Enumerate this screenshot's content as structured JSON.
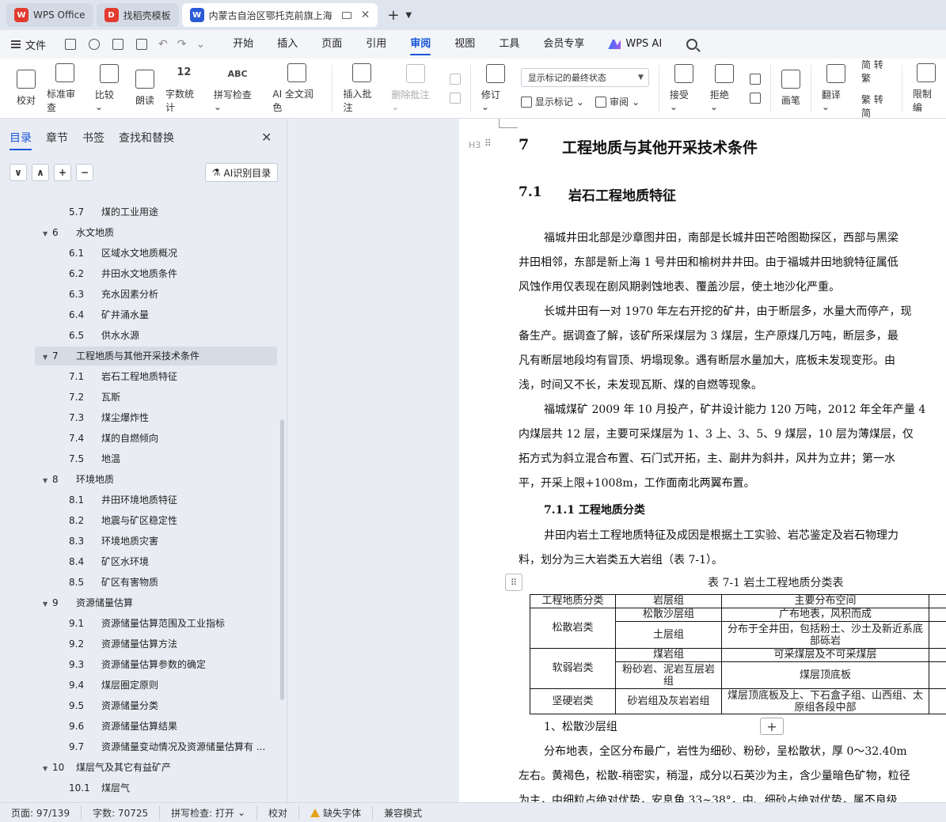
{
  "tabs": [
    {
      "label": "WPS Office",
      "logo": "W",
      "logo_color": "#e23b2e"
    },
    {
      "label": "找稻壳模板",
      "logo": "D",
      "logo_color": "#e23b2e"
    },
    {
      "label": "内蒙古自治区鄂托克前旗上海",
      "logo": "W",
      "logo_color": "#2a5bd7",
      "active": true
    }
  ],
  "menubar": {
    "file": "文件",
    "items": [
      "开始",
      "插入",
      "页面",
      "引用",
      "审阅",
      "视图",
      "工具",
      "会员专享"
    ],
    "active": "审阅",
    "wps_ai": "WPS AI"
  },
  "ribbon": {
    "proofread": "校对",
    "standard_review": "标准审查",
    "compare": "比较",
    "read_aloud": "朗读",
    "word_count": "字数统计",
    "word_count_icon_text": "12",
    "spell_check": "拼写检查",
    "spell_check_icon_text": "ABC",
    "ai_polish": "AI 全文润色",
    "insert_comment": "插入批注",
    "delete_comment": "删除批注",
    "revision": "修订",
    "markup_select": "显示标记的最终状态",
    "show_markup": "显示标记",
    "review": "审阅",
    "accept": "接受",
    "reject": "拒绝",
    "brush": "画笔",
    "translate": "翻译",
    "to_traditional": "简 转繁",
    "to_simplified": "繁 转简",
    "restrict_edit": "限制编"
  },
  "nav": {
    "tabs": [
      "目录",
      "章节",
      "书签",
      "查找和替换"
    ],
    "active_tab": "目录",
    "tools": [
      "∨",
      "∧",
      "+",
      "−"
    ],
    "ai_toc": "AI识别目录",
    "items": [
      {
        "num": "5.7",
        "text": "煤的工业用途",
        "level": 2
      },
      {
        "num": "6",
        "text": "水文地质",
        "level": 1
      },
      {
        "num": "6.1",
        "text": "区域水文地质概况",
        "level": 2
      },
      {
        "num": "6.2",
        "text": "井田水文地质条件",
        "level": 2
      },
      {
        "num": "6.3",
        "text": "充水因素分析",
        "level": 2
      },
      {
        "num": "6.4",
        "text": "矿井涌水量",
        "level": 2
      },
      {
        "num": "6.5",
        "text": "供水水源",
        "level": 2
      },
      {
        "num": "7",
        "text": "工程地质与其他开采技术条件",
        "level": 1,
        "selected": true
      },
      {
        "num": "7.1",
        "text": "岩石工程地质特征",
        "level": 2
      },
      {
        "num": "7.2",
        "text": "瓦斯",
        "level": 2
      },
      {
        "num": "7.3",
        "text": "煤尘爆炸性",
        "level": 2
      },
      {
        "num": "7.4",
        "text": "煤的自燃倾向",
        "level": 2
      },
      {
        "num": "7.5",
        "text": "地温",
        "level": 2
      },
      {
        "num": "8",
        "text": "环境地质",
        "level": 1
      },
      {
        "num": "8.1",
        "text": "井田环境地质特征",
        "level": 2
      },
      {
        "num": "8.2",
        "text": "地震与矿区稳定性",
        "level": 2
      },
      {
        "num": "8.3",
        "text": "环境地质灾害",
        "level": 2
      },
      {
        "num": "8.4",
        "text": "矿区水环境",
        "level": 2
      },
      {
        "num": "8.5",
        "text": "矿区有害物质",
        "level": 2
      },
      {
        "num": "9",
        "text": "资源储量估算",
        "level": 1
      },
      {
        "num": "9.1",
        "text": "资源储量估算范围及工业指标",
        "level": 2
      },
      {
        "num": "9.2",
        "text": "资源储量估算方法",
        "level": 2
      },
      {
        "num": "9.3",
        "text": "资源储量估算参数的确定",
        "level": 2
      },
      {
        "num": "9.4",
        "text": "煤层圈定原则",
        "level": 2
      },
      {
        "num": "9.5",
        "text": "资源储量分类",
        "level": 2
      },
      {
        "num": "9.6",
        "text": "资源储量估算结果",
        "level": 2
      },
      {
        "num": "9.7",
        "text": "资源储量变动情况及资源储量估算有 ...",
        "level": 2
      },
      {
        "num": "10",
        "text": "煤层气及其它有益矿产",
        "level": 1
      },
      {
        "num": "10.1",
        "text": "煤层气",
        "level": 2
      }
    ]
  },
  "doc": {
    "heading_marker": "H3",
    "h1_num": "7",
    "h1_text": "工程地质与其他开采技术条件",
    "h2_num": "7.1",
    "h2_text": "岩石工程地质特征",
    "lines": [
      "福城井田北部是沙章图井田，南部是长城井田芒哈图勘探区，西部与黑梁",
      "井田相邻，东部是新上海 1 号井田和榆树井井田。由于福城井田地貌特征属低",
      "风蚀作用仅表现在剧风期剥蚀地表、覆盖沙层，使土地沙化严重。",
      "长城井田有一对 1970 年左右开挖的矿井，由于断层多，水量大而停产，现",
      "备生产。据调查了解，该矿所采煤层为 3 煤层，生产原煤几万吨，断层多，最",
      "凡有断层地段均有冒顶、坍塌现象。遇有断层水量加大，底板未发现变形。由",
      "浅，时间又不长，未发现瓦斯、煤的自燃等现象。",
      "福城煤矿 2009 年 10 月投产，矿井设计能力 120 万吨，2012 年全年产量 4",
      "内煤层共 12 层，主要可采煤层为 1、3 上、3、5、9 煤层，10 层为薄煤层，仅",
      "拓方式为斜立混合布置、石门式开拓，主、副井为斜井，风井为立井；第一水",
      "平，开采上限+1008m，工作面南北两翼布置。"
    ],
    "h3_text": "7.1.1  工程地质分类",
    "lines2": [
      "井田内岩土工程地质特征及成因是根据土工实验、岩芯鉴定及岩石物理力",
      "料，划分为三大岩类五大岩组（表 7-1）。"
    ],
    "table_caption": "表 7-1  岩土工程地质分类表",
    "table": {
      "headers": [
        "工程地质分类",
        "岩层组",
        "主要分布空间"
      ],
      "class_soft_loose": "松散岩类",
      "class_weak": "软弱岩类",
      "class_hard": "坚硬岩类",
      "r1_group": "松散沙层组",
      "r1_dist": "广布地表，风积而成",
      "r2_group": "土层组",
      "r2_dist": "分布于全井田，包括粉土、沙土及新近系底部砾岩",
      "r3_group": "煤岩组",
      "r3_dist": "可采煤层及不可采煤层",
      "r4_group": "粉砂岩、泥岩互层岩组",
      "r4_dist": "煤层顶底板",
      "r5_group": "砂岩组及灰岩岩组",
      "r5_dist": "煤层顶底板及上、下石盒子组、山西组、太原组各段中部"
    },
    "item1": "1、松散沙层组",
    "lines3": [
      "分布地表，全区分布最广，岩性为细砂、粉砂，呈松散状，厚 0～32.40m",
      "左右。黄褐色，松散-稍密实，稍湿，成分以石英沙为主，含少量暗色矿物，粒径",
      "为主，中细粒占绝对优势，安息角 33~38°，中、细砂占绝对优势，属不良级"
    ]
  },
  "status": {
    "page": "页面: 97/139",
    "words": "字数: 70725",
    "spell": "拼写检查: 打开",
    "proof": "校对",
    "missing_font": "缺失字体",
    "compat": "兼容模式"
  }
}
